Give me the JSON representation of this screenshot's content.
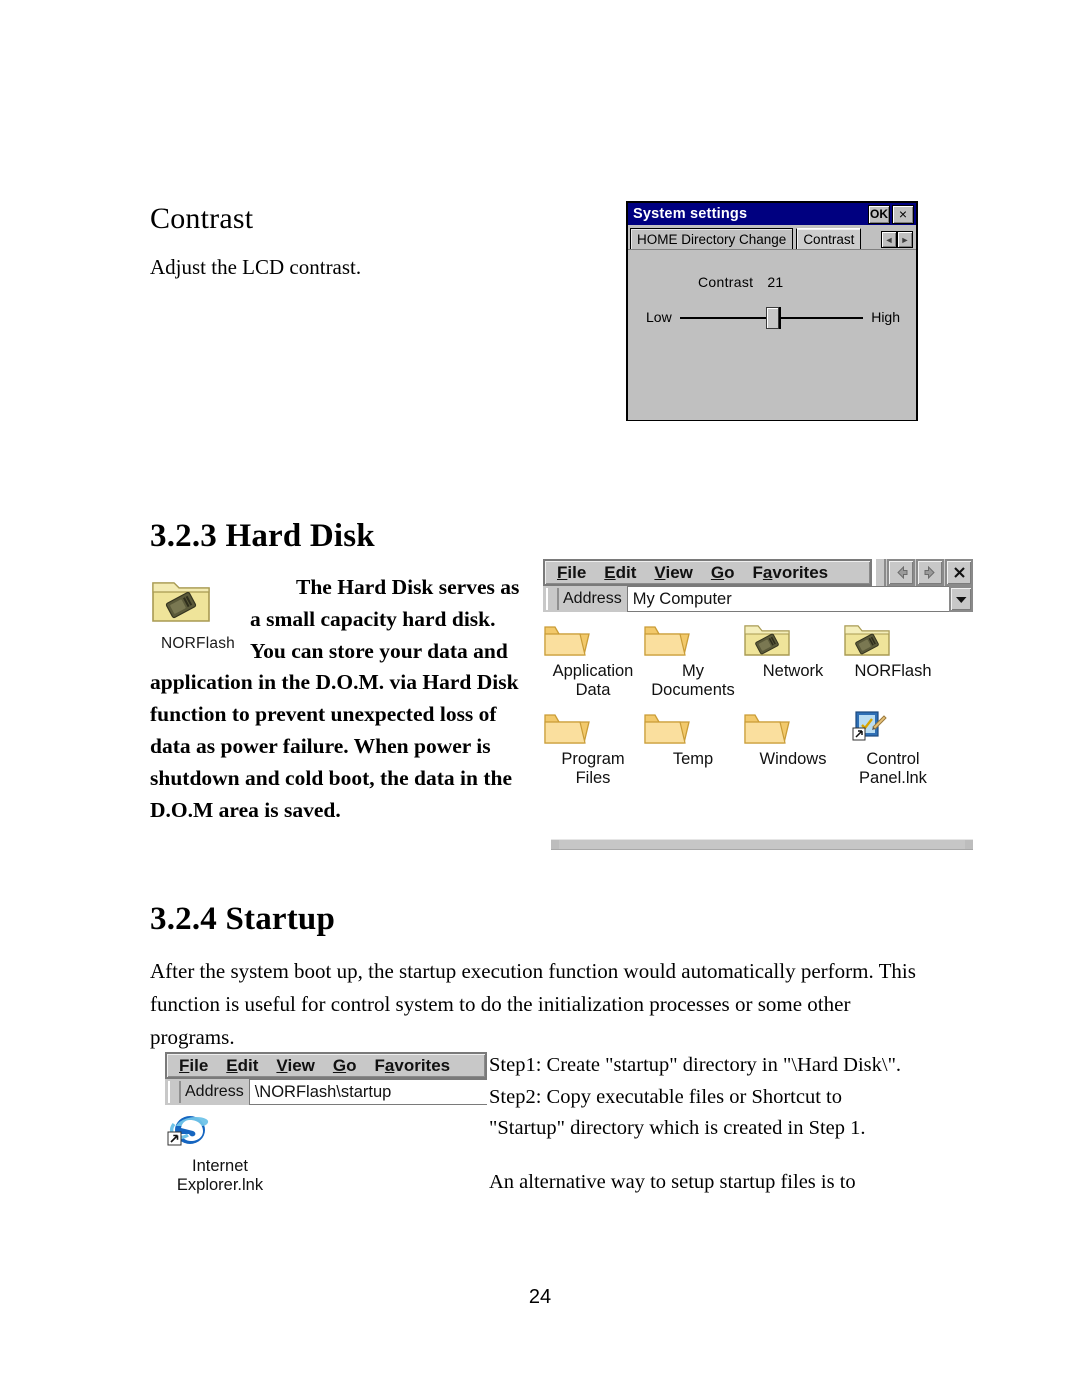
{
  "page": {
    "number": "24"
  },
  "contrast_section": {
    "heading": "Contrast",
    "body": "Adjust the LCD contrast."
  },
  "system_settings_dialog": {
    "title": "System settings",
    "ok_label": "OK",
    "close_label": "×",
    "tabs": [
      {
        "label": "HOME Directory Change",
        "active": false
      },
      {
        "label": "Contrast",
        "active": true
      }
    ],
    "spin_prev": "◄",
    "spin_next": "►",
    "contrast": {
      "label": "Contrast",
      "value": "21",
      "low_label": "Low",
      "high_label": "High",
      "slider_percent": 47
    }
  },
  "hard_disk_section": {
    "heading": "3.2.3 Hard Disk",
    "icon_label": "NORFlash",
    "body": "The Hard Disk serves as a small capacity hard disk. You can store your data and application in the D.O.M. via Hard Disk function to prevent unexpected loss of data as power failure. When power is shutdown and cold boot, the data in the D.O.M area is saved."
  },
  "explorer_mycomputer": {
    "menus": [
      "File",
      "Edit",
      "View",
      "Go",
      "Favorites"
    ],
    "nav_back": "◄",
    "nav_forward": "►",
    "nav_close": "✕",
    "address_label": "Address",
    "address_value": "My Computer",
    "dropdown_glyph": "▼",
    "items": [
      {
        "caption": "Application\nData",
        "icon": "folder-plain"
      },
      {
        "caption": "My\nDocuments",
        "icon": "folder-plain"
      },
      {
        "caption": "Network",
        "icon": "folder-chip"
      },
      {
        "caption": "NORFlash",
        "icon": "folder-chip"
      },
      {
        "caption": "Program Files",
        "icon": "folder-plain"
      },
      {
        "caption": "Temp",
        "icon": "folder-plain"
      },
      {
        "caption": "Windows",
        "icon": "folder-plain"
      },
      {
        "caption": "Control\nPanel.lnk",
        "icon": "control-panel-shortcut"
      }
    ]
  },
  "startup_section": {
    "heading": "3.2.4 Startup",
    "body": "After the system boot up, the startup execution function would automatically perform. This function is useful for control system to do the initialization processes or some other programs.",
    "step1": "Step1: Create \"startup\" directory in \"\\Hard Disk\\\".",
    "step2": "Step2: Copy executable files or Shortcut to \"Startup\" directory which is created in Step 1.",
    "alternative": "An alternative way to setup startup files is to"
  },
  "explorer_startup": {
    "menus": [
      "File",
      "Edit",
      "View",
      "Go",
      "Favorites"
    ],
    "address_label": "Address",
    "address_value": "\\NORFlash\\startup",
    "items": [
      {
        "caption": "Internet\nExplorer.lnk",
        "icon": "internet-explorer-shortcut"
      }
    ]
  },
  "colors": {
    "titlebar": "#000080",
    "dialog_face": "#c0c0c0",
    "explorer_chrome": "#c8c8c8",
    "folder_body": "#f5d88a",
    "folder_flash": "#e8e08c",
    "ie_blue": "#1565c0"
  }
}
